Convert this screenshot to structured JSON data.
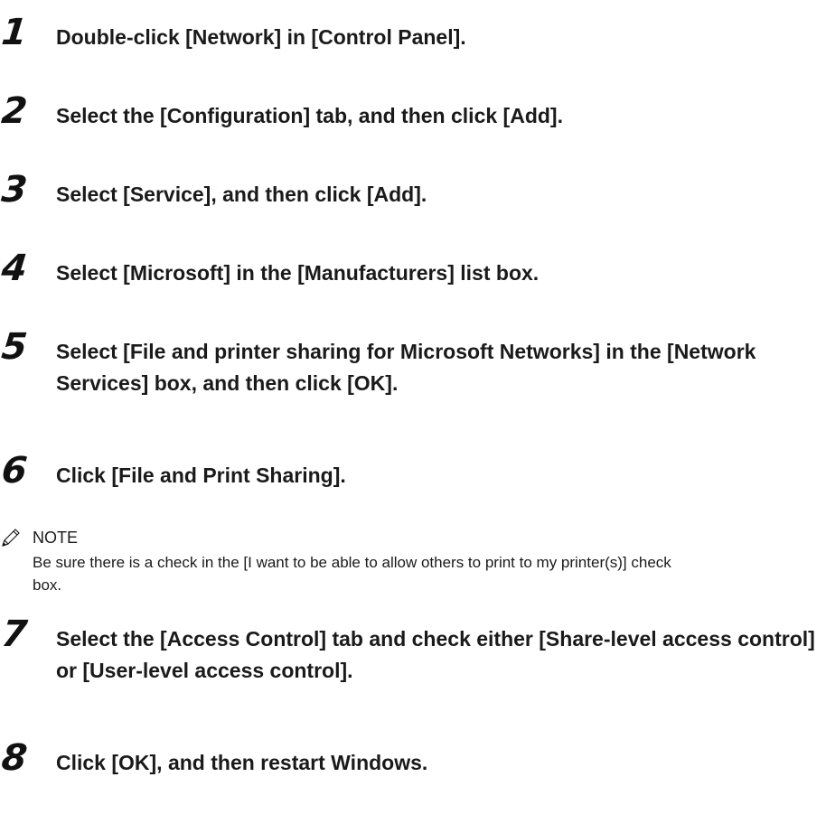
{
  "steps": [
    {
      "number": "1",
      "text": "Double-click [Network] in [Control Panel]."
    },
    {
      "number": "2",
      "text": "Select the [Configuration] tab, and then click [Add]."
    },
    {
      "number": "3",
      "text": "Select [Service], and then click [Add]."
    },
    {
      "number": "4",
      "text": "Select [Microsoft] in the [Manufacturers] list box."
    },
    {
      "number": "5",
      "text": "Select [File and printer sharing for Microsoft Networks] in the [Network Services] box, and then click [OK]."
    },
    {
      "number": "6",
      "text": "Click [File and Print Sharing]."
    },
    {
      "number": "7",
      "text": "Select the [Access Control] tab and check either [Share-level access control] or [User-level access control]."
    },
    {
      "number": "8",
      "text": "Click [OK], and then restart Windows."
    }
  ],
  "note": {
    "icon": "pencil-icon",
    "label": "NOTE",
    "text": "Be sure there is a check in the [I want to be able to allow others to print to my printer(s)] check box."
  }
}
